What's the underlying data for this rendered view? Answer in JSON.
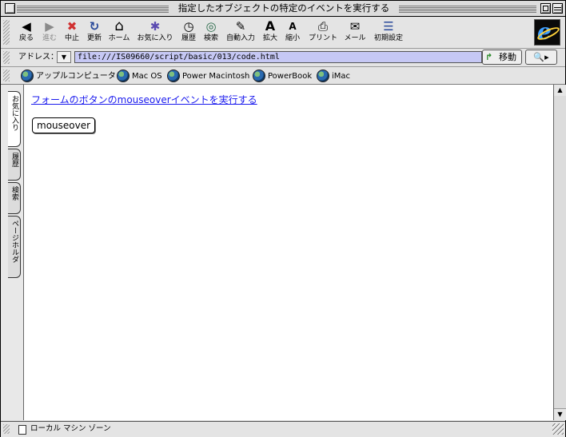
{
  "window": {
    "title": "指定したオブジェクトの特定のイベントを実行する"
  },
  "toolbar": {
    "buttons": [
      {
        "label": "戻る",
        "icon": "◀",
        "enabled": true
      },
      {
        "label": "進む",
        "icon": "▶",
        "enabled": false
      },
      {
        "label": "中止",
        "icon": "✖",
        "enabled": true
      },
      {
        "label": "更新",
        "icon": "↻",
        "enabled": true
      },
      {
        "label": "ホーム",
        "icon": "⌂",
        "enabled": true
      },
      {
        "label": "お気に入り",
        "icon": "✱",
        "enabled": true
      },
      {
        "label": "履歴",
        "icon": "◷",
        "enabled": true
      },
      {
        "label": "検索",
        "icon": "◎",
        "enabled": true
      },
      {
        "label": "自動入力",
        "icon": "✎",
        "enabled": true
      },
      {
        "label": "拡大",
        "icon": "A",
        "enabled": true
      },
      {
        "label": "縮小",
        "icon": "A",
        "enabled": true
      },
      {
        "label": "プリント",
        "icon": "⎙",
        "enabled": true
      },
      {
        "label": "メール",
        "icon": "✉",
        "enabled": true
      },
      {
        "label": "初期設定",
        "icon": "☰",
        "enabled": true
      }
    ]
  },
  "address": {
    "label": "アドレス：",
    "url": "file:///IS09660/script/basic/013/code.html",
    "go_label": "移動",
    "go_icon": "↱",
    "search_icon": "🔍"
  },
  "favorites": [
    "アップルコンピュータ",
    "Mac OS",
    "Power Macintosh",
    "PowerBook",
    "iMac"
  ],
  "sidebar_tabs": [
    "お気に入り",
    "履歴",
    "検索",
    "ページホルダ"
  ],
  "page": {
    "link_text": "フォームのボタンのmouseoverイベントを実行する",
    "button_label": "mouseover"
  },
  "status": {
    "text": "ローカル マシン ゾーン"
  },
  "colors": {
    "link": "#1a1aee",
    "url_field": "#c6c8f4"
  }
}
